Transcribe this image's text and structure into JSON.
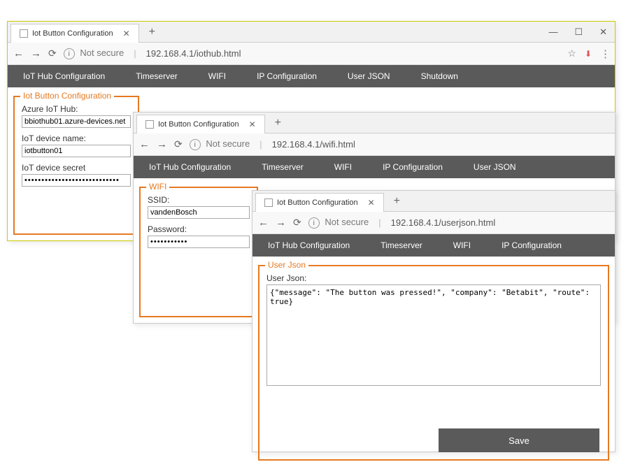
{
  "tab_title": "Iot Button Configuration",
  "not_secure_text": "Not secure",
  "win1": {
    "url": "192.168.4.1/iothub.html",
    "nav": [
      "IoT Hub Configuration",
      "Timeserver",
      "WIFI",
      "IP Configuration",
      "User JSON",
      "Shutdown"
    ],
    "fieldset_title": "Iot Button Configuration",
    "rows": [
      {
        "label": "Azure IoT Hub:",
        "value": "bbiothub01.azure-devices.net"
      },
      {
        "label": "IoT device name:",
        "value": "iotbutton01"
      },
      {
        "label": "IoT device secret",
        "value": "••••••••••••••••••••••••••••"
      }
    ]
  },
  "win2": {
    "url": "192.168.4.1/wifi.html",
    "nav": [
      "IoT Hub Configuration",
      "Timeserver",
      "WIFI",
      "IP Configuration",
      "User JSON"
    ],
    "fieldset_title": "WIFI",
    "rows": [
      {
        "label": "SSID:",
        "value": "vandenBosch"
      },
      {
        "label": "Password:",
        "value": "•••••••••••"
      }
    ]
  },
  "win3": {
    "url": "192.168.4.1/userjson.html",
    "nav": [
      "IoT Hub Configuration",
      "Timeserver",
      "WIFI",
      "IP Configuration"
    ],
    "fieldset_title": "User Json",
    "label": "User Json:",
    "textarea_value": "{\"message\": \"The button was pressed!\", \"company\": \"Betabit\", \"route\": true}",
    "save_label": "Save"
  }
}
